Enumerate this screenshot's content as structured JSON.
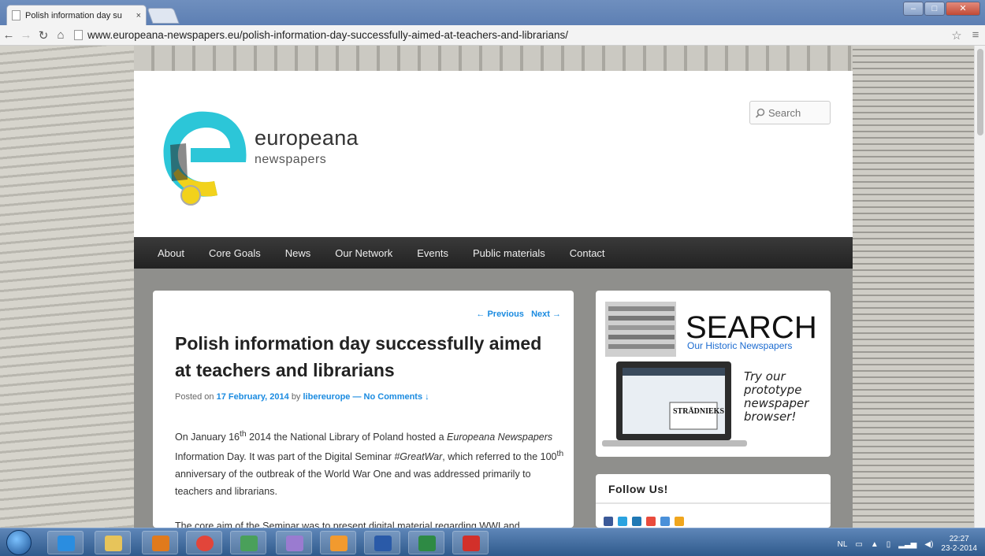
{
  "browser": {
    "tab_title": "Polish information day su",
    "tab_close": "×",
    "url": "www.europeana-newspapers.eu/polish-information-day-successfully-aimed-at-teachers-and-librarians/",
    "icons": [
      "back-icon",
      "forward-icon",
      "reload-icon",
      "home-icon",
      "page-icon",
      "star-icon",
      "menu-icon"
    ]
  },
  "site": {
    "brand_name": "europeana",
    "brand_sub": "newspapers",
    "search_placeholder": "Search",
    "menu": [
      "About",
      "Core Goals",
      "News",
      "Our Network",
      "Events",
      "Public materials",
      "Contact"
    ],
    "post": {
      "nav_previous": "← Previous",
      "nav_next": "Next →",
      "title": "Polish information day successfully aimed at teachers and librarians",
      "meta_posted_on": "Posted on",
      "meta_date": "17 February, 2014",
      "meta_by": "by",
      "meta_author": "libereurope",
      "meta_sep": "—",
      "meta_comments": "No Comments ↓",
      "p1": {
        "a": "On January 16",
        "sup1": "th",
        "b": " 2014 the National Library of Poland hosted a ",
        "em1": "Europeana Newspapers",
        "c": " Information Day. It was part of the Digital Seminar ",
        "em2": "#GreatWar",
        "d": ", which referred to the 100",
        "sup2": "th",
        "e": " anniversary of the outbreak of the World War One and was addressed primarily to teachers and librarians."
      },
      "p2": "The core aim of the Seminar was to present digital material regarding WWI and"
    },
    "ad": {
      "headline": "SEARCH",
      "subhead": "Our Historic Newspapers",
      "tagline": "Try our prototype newspaper browser!",
      "screen_title": "STRĀDNIEKS"
    },
    "follow_title": "Follow Us!"
  },
  "colors": {
    "link": "#1b8be0",
    "menu_bg": "#2a2a2a",
    "accent_cyan": "#2cc6d8",
    "accent_yellow": "#f2d21c"
  },
  "taskbar": {
    "lang": "NL",
    "time": "22:27",
    "date": "23-2-2014",
    "apps": [
      "internet-explorer",
      "file-explorer",
      "media-player",
      "chrome",
      "remote-desktop",
      "paint",
      "outlook",
      "word",
      "excel",
      "acrobat"
    ]
  }
}
